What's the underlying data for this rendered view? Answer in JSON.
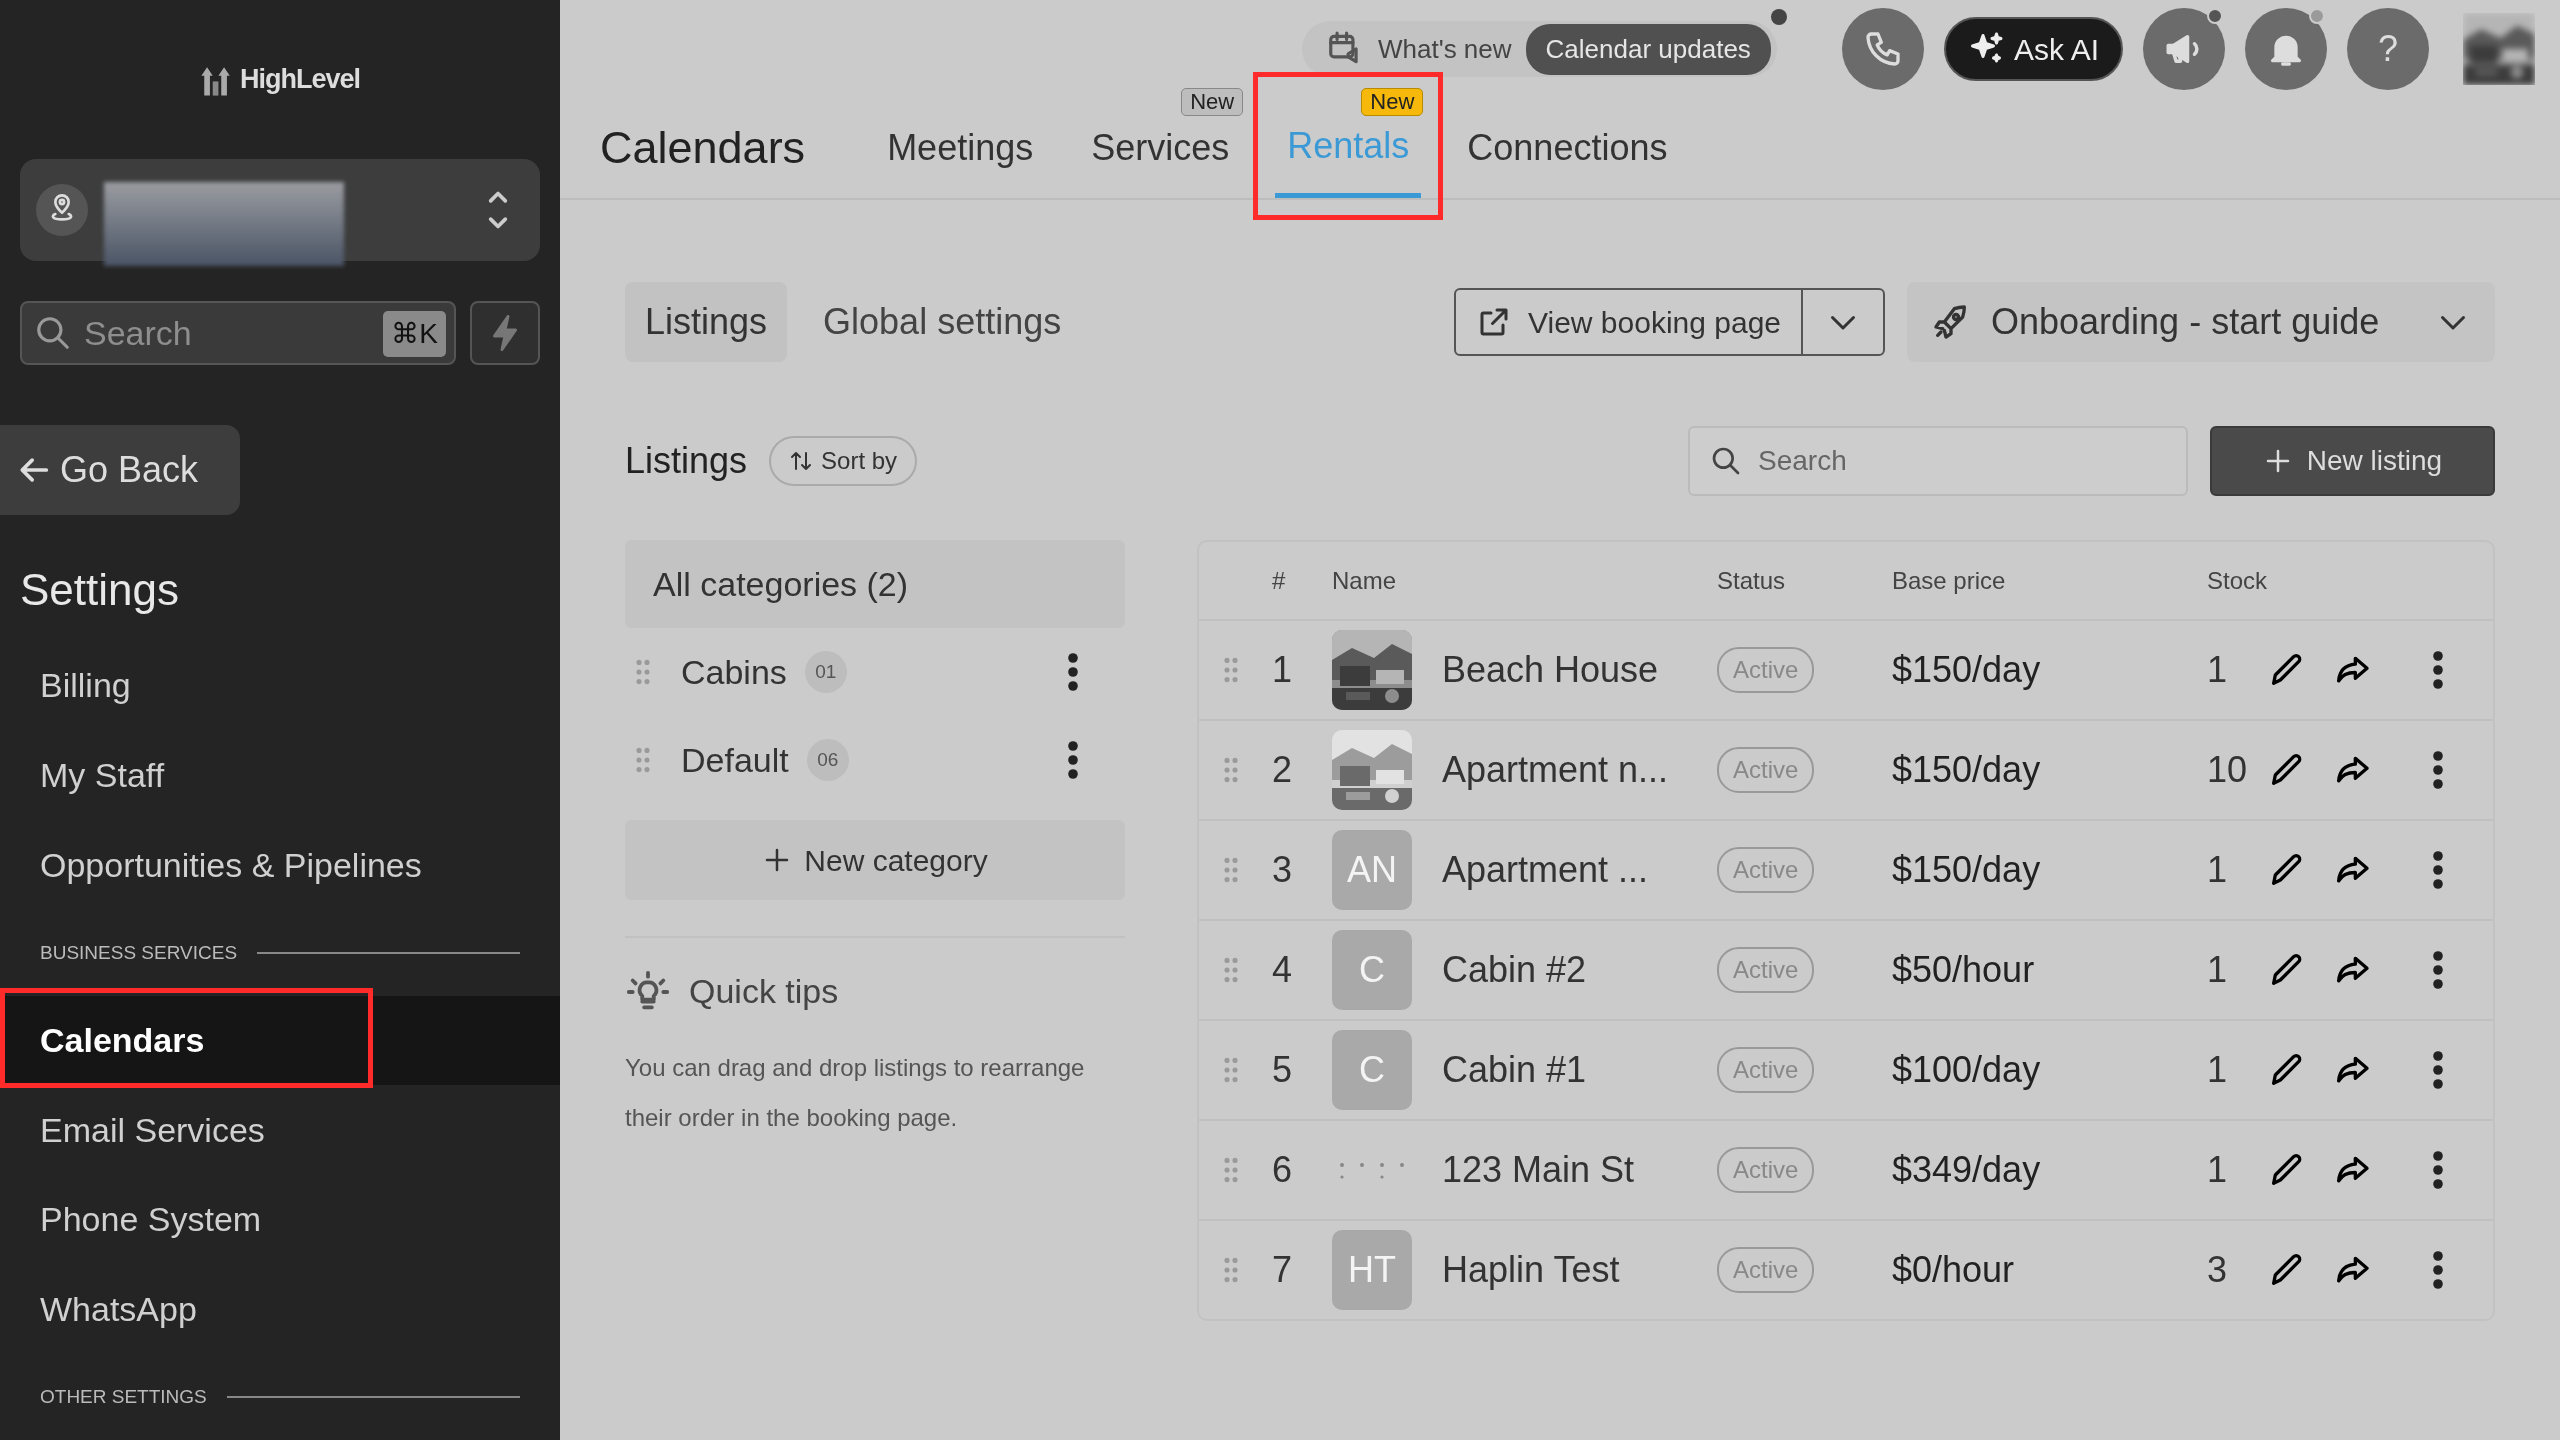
{
  "sidebar": {
    "logo": "HighLevel",
    "search": {
      "placeholder": "Search",
      "shortcut": "⌘K"
    },
    "back": "Go Back",
    "heading": "Settings",
    "items": [
      {
        "kind": "link",
        "label": "Billing",
        "selected": false,
        "annotated": false
      },
      {
        "kind": "link",
        "label": "My Staff",
        "selected": false,
        "annotated": false
      },
      {
        "kind": "link",
        "label": "Opportunities & Pipelines",
        "selected": false,
        "annotated": false
      },
      {
        "kind": "section",
        "label": "BUSINESS SERVICES"
      },
      {
        "kind": "link",
        "label": "Calendars",
        "selected": true,
        "annotated": true
      },
      {
        "kind": "link",
        "label": "Email Services",
        "selected": false,
        "annotated": false
      },
      {
        "kind": "link",
        "label": "Phone System",
        "selected": false,
        "annotated": false
      },
      {
        "kind": "link",
        "label": "WhatsApp",
        "selected": false,
        "annotated": false
      },
      {
        "kind": "section",
        "label": "OTHER SETTINGS"
      }
    ]
  },
  "topbar": {
    "whats_new": "What's new",
    "updates": "Calendar updates",
    "updates_notification": true,
    "buttons": [
      {
        "kind": "phone",
        "notification": false
      },
      {
        "kind": "ai",
        "label": "Ask AI",
        "notification": false
      },
      {
        "kind": "megaphone",
        "notification": true
      },
      {
        "kind": "bell",
        "notification": true
      },
      {
        "kind": "help",
        "label": "?",
        "notification": false
      }
    ]
  },
  "header": {
    "title": "Calendars",
    "tabs": [
      {
        "label": "Meetings",
        "selected": false,
        "annotated": false
      },
      {
        "label": "Services",
        "badge": {
          "text": "New",
          "kind": "plain"
        },
        "selected": false,
        "annotated": false
      },
      {
        "label": "Rentals",
        "badge": {
          "text": "New",
          "kind": "highlight"
        },
        "selected": true,
        "annotated": true
      },
      {
        "label": "Connections",
        "selected": false,
        "annotated": false
      }
    ]
  },
  "subtabs": [
    {
      "label": "Listings",
      "selected": true
    },
    {
      "label": "Global settings",
      "selected": false
    }
  ],
  "view_booking": "View booking page",
  "onboarding": "Onboarding - start guide",
  "listings": {
    "title": "Listings",
    "sort": "Sort by",
    "search_placeholder": "Search",
    "new_button": "New listing"
  },
  "categories": {
    "all": "All categories (2)",
    "items": [
      {
        "name": "Cabins",
        "count": "01"
      },
      {
        "name": "Default",
        "count": "06"
      }
    ],
    "new_button": "New category"
  },
  "tips": {
    "title": "Quick tips",
    "text": "You can drag and drop listings to rearrange their order in the booking page."
  },
  "table": {
    "columns": [
      "#",
      "Name",
      "Status",
      "Base price",
      "Stock"
    ],
    "rows": [
      {
        "number": "1",
        "name": "Beach House",
        "status": "Active",
        "price": "$150/day",
        "stock": "1"
      },
      {
        "number": "2",
        "name": "Apartment n...",
        "status": "Active",
        "price": "$150/day",
        "stock": "10"
      },
      {
        "number": "3",
        "thumb": {
          "kind": "initials",
          "text": "AN"
        },
        "name": "Apartment ...",
        "status": "Active",
        "price": "$150/day",
        "stock": "1"
      },
      {
        "number": "4",
        "thumb": {
          "kind": "initials",
          "text": "C"
        },
        "name": "Cabin #2",
        "status": "Active",
        "price": "$50/hour",
        "stock": "1"
      },
      {
        "number": "5",
        "thumb": {
          "kind": "initials",
          "text": "C"
        },
        "name": "Cabin #1",
        "status": "Active",
        "price": "$100/day",
        "stock": "1"
      },
      {
        "number": "6",
        "thumb": {
          "kind": "loading"
        },
        "name": "123 Main St",
        "status": "Active",
        "price": "$349/day",
        "stock": "1"
      },
      {
        "number": "7",
        "thumb": {
          "kind": "initials",
          "text": "HT"
        },
        "name": "Haplin Test",
        "status": "Active",
        "price": "$0/hour",
        "stock": "3"
      }
    ]
  }
}
